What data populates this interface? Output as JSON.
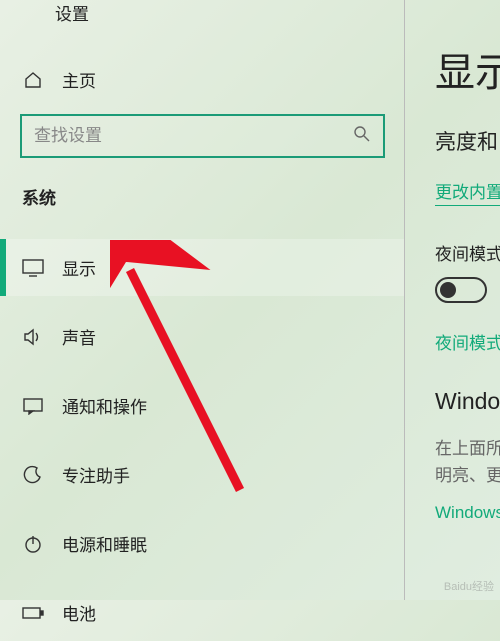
{
  "window": {
    "title": "设置"
  },
  "sidebar": {
    "home": "主页",
    "search_placeholder": "查找设置",
    "category": "系统",
    "items": [
      {
        "label": "显示"
      },
      {
        "label": "声音"
      },
      {
        "label": "通知和操作"
      },
      {
        "label": "专注助手"
      },
      {
        "label": "电源和睡眠"
      },
      {
        "label": "电池"
      }
    ]
  },
  "content": {
    "title": "显示",
    "brightness_heading": "亮度和",
    "brightness_link": "更改内置",
    "night_mode_label": "夜间模式",
    "night_mode_link": "夜间模式",
    "hd_heading": "Windows",
    "hd_desc1": "在上面所",
    "hd_desc2": "明亮、更",
    "hd_link": "Windows"
  },
  "watermark": "Baidu经验"
}
